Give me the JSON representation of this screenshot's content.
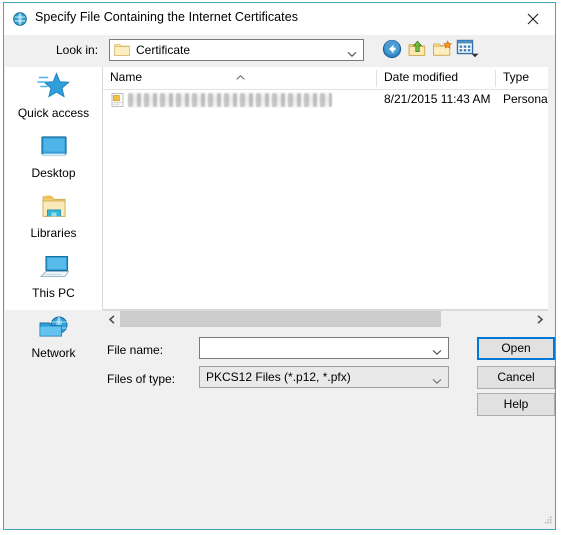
{
  "window": {
    "title": "Specify File Containing the Internet Certificates",
    "title_icon": "globe-icon",
    "close_label": "✕",
    "border_color": "#3fa7b5",
    "background_color": "#f0f0f0"
  },
  "toolbar": {
    "lookin_label": "Look in:",
    "lookin_value": "Certificate",
    "lookin_icon": "folder-icon",
    "buttons": [
      {
        "name": "back-button",
        "icon": "back-arrow-icon",
        "tooltip": "Back"
      },
      {
        "name": "up-button",
        "icon": "up-folder-icon",
        "tooltip": "Up one level"
      },
      {
        "name": "new-folder-button",
        "icon": "new-folder-icon",
        "tooltip": "Create New Folder"
      },
      {
        "name": "views-button",
        "icon": "views-grid-icon",
        "tooltip": "Views"
      }
    ]
  },
  "places": {
    "items": [
      {
        "label": "Quick access",
        "icon": "star-icon"
      },
      {
        "label": "Desktop",
        "icon": "monitor-icon"
      },
      {
        "label": "Libraries",
        "icon": "libraries-folder-icon"
      },
      {
        "label": "This PC",
        "icon": "computer-icon"
      },
      {
        "label": "Network",
        "icon": "network-globe-icon"
      }
    ]
  },
  "filelist": {
    "columns": [
      {
        "label": "Name",
        "sorted": "ascending"
      },
      {
        "label": "Date modified",
        "sorted": ""
      },
      {
        "label": "Type",
        "sorted": ""
      }
    ],
    "rows": [
      {
        "name": "",
        "name_redacted": true,
        "date_modified": "8/21/2015 11:43 AM",
        "type": "Personal I",
        "icon": "certificate-file-icon"
      }
    ],
    "scroll": {
      "orientation": "horizontal",
      "thumb_percent": 73
    }
  },
  "form": {
    "filename_label": "File name:",
    "filename_value": "",
    "filename_placeholder": "",
    "filetype_label": "Files of type:",
    "filetype_value": "PKCS12 Files (*.p12, *.pfx)"
  },
  "buttons": {
    "open": "Open",
    "cancel": "Cancel",
    "help": "Help",
    "default_button": "open",
    "focus_color": "#0078d7"
  }
}
